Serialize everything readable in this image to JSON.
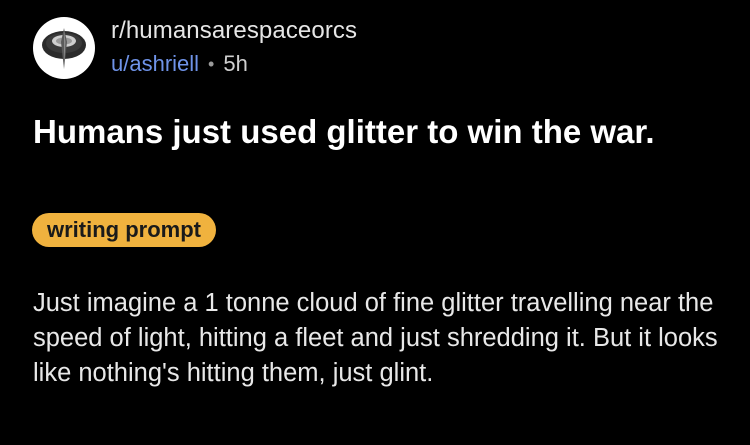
{
  "post": {
    "subreddit": "r/humansarespaceorcs",
    "username": "u/ashriell",
    "separator": "•",
    "age": "5h",
    "title": "Humans just used glitter to win the war.",
    "flair": "writing prompt",
    "body": "Just imagine a 1 tonne cloud of fine glitter travelling near the speed of light, hitting a fleet and just shredding it. But it looks like nothing's hitting them, just glint."
  },
  "colors": {
    "background": "#000000",
    "username": "#6f93e8",
    "flair_bg": "#f0b23e",
    "flair_text": "#1a1a1a"
  },
  "icons": {
    "avatar": "subreddit-avatar-icon"
  }
}
